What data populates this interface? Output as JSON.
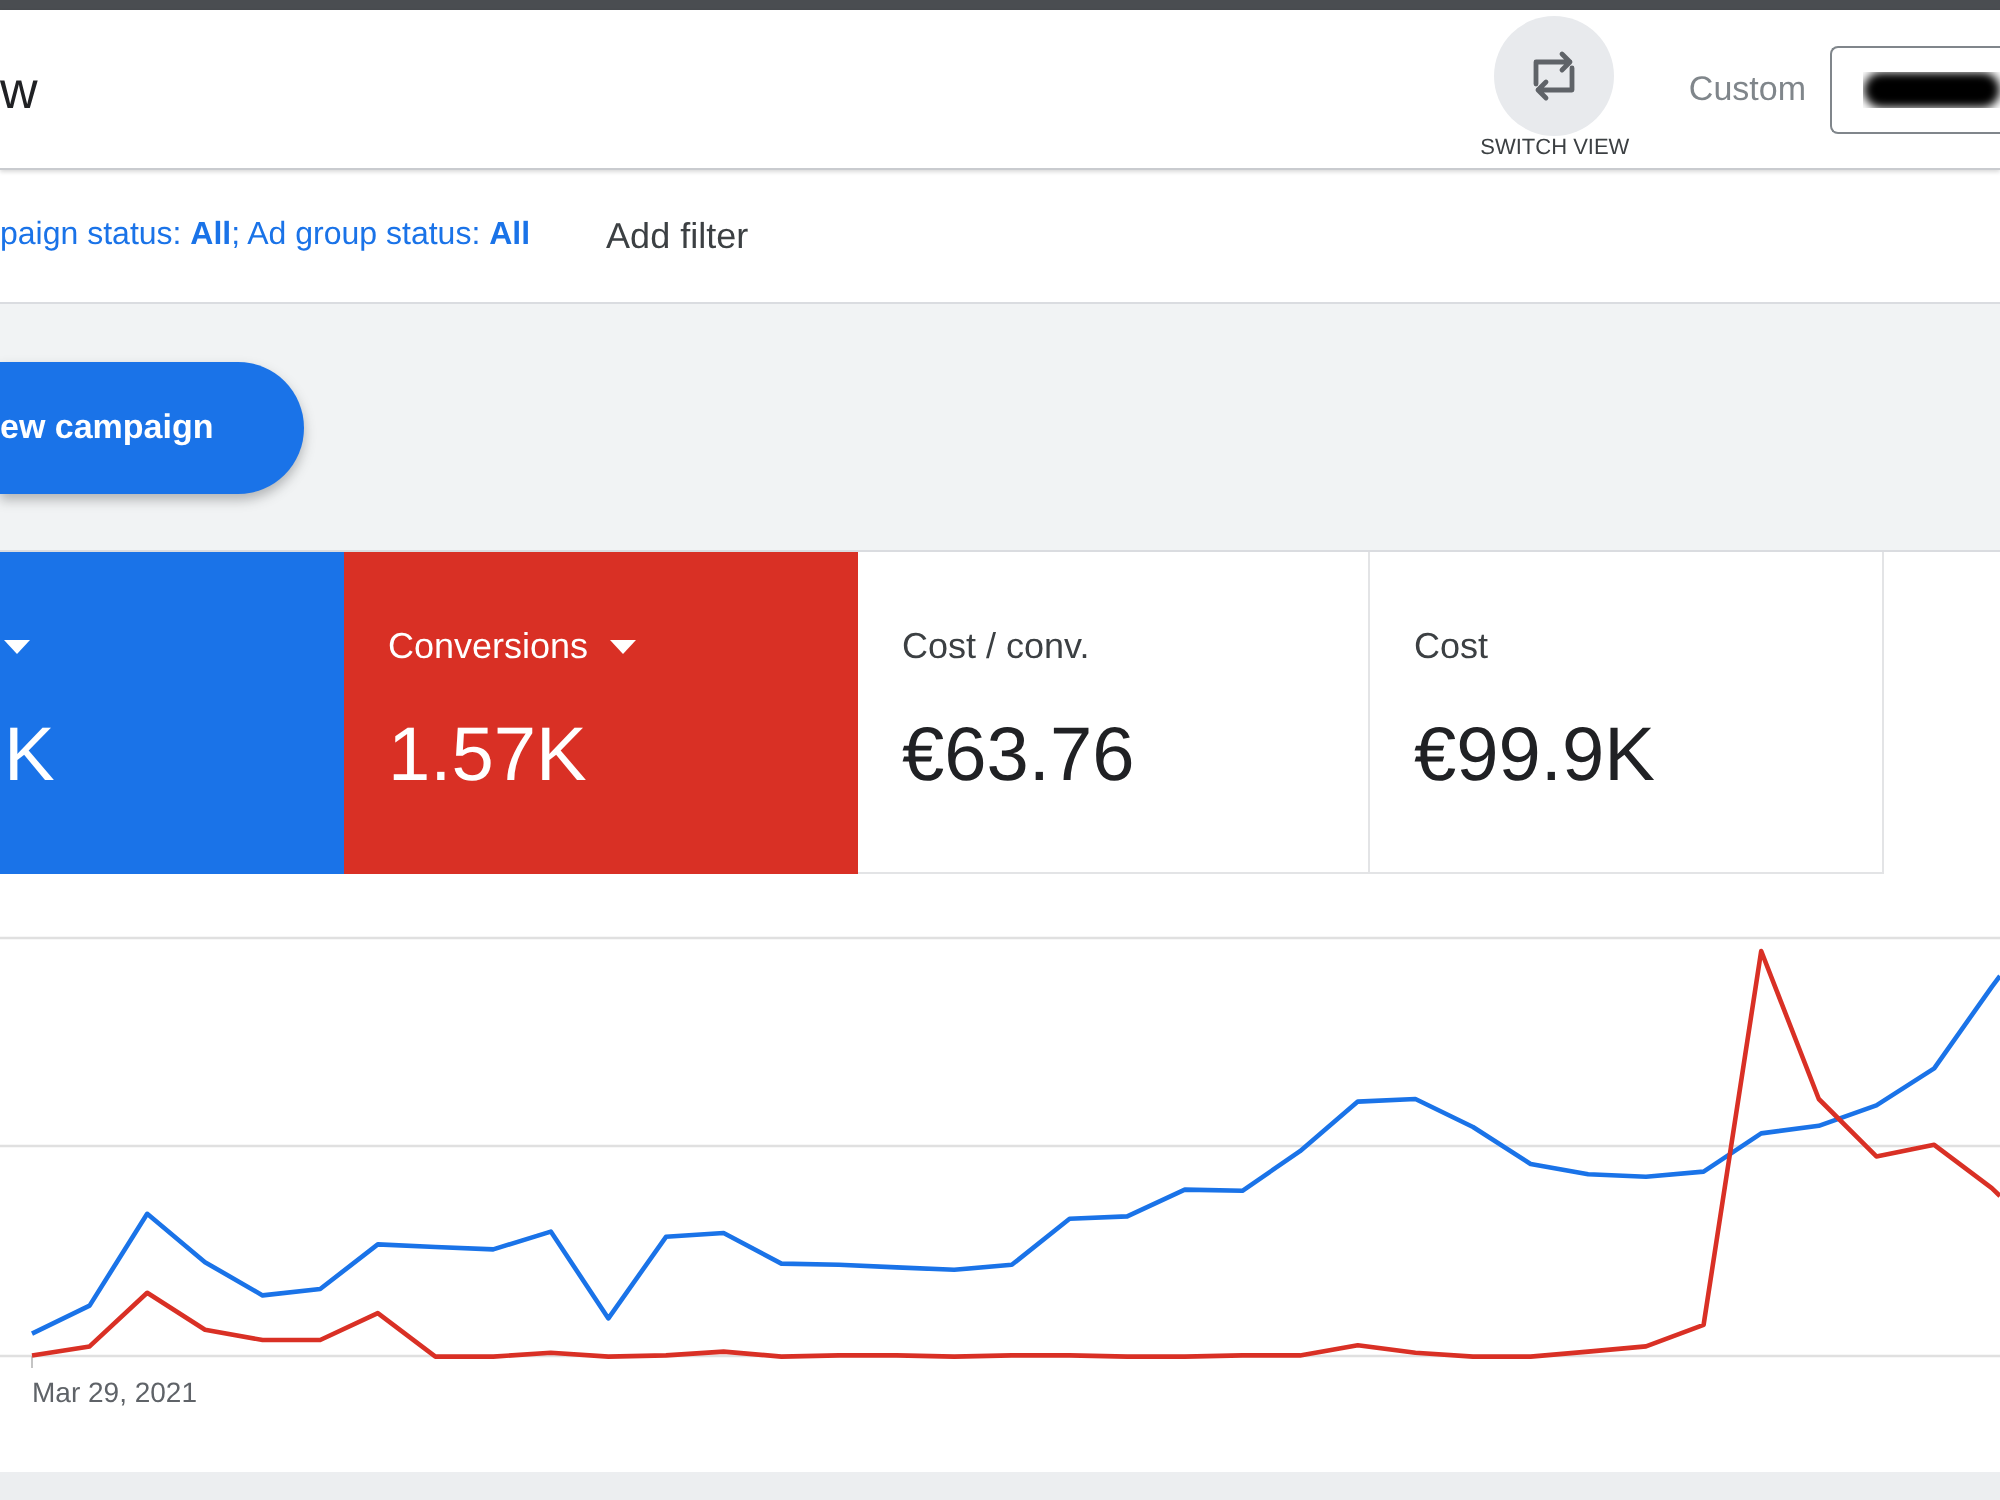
{
  "header": {
    "title": "w",
    "switch_view_label": "SWITCH VIEW",
    "date_range_label": "Custom"
  },
  "filter_bar": {
    "summary": "paign status: **All**; Ad group status: **All**",
    "add_filter": "Add filter"
  },
  "toolbar": {
    "new_campaign": "ew campaign"
  },
  "metric_cards": [
    {
      "value": "K",
      "selected": true,
      "color": "#1a73e8"
    },
    {
      "label": "Conversions",
      "value": "1.57K",
      "selected": true,
      "color": "#d93025"
    },
    {
      "label": "Cost / conv.",
      "value": "€63.76",
      "selected": false
    },
    {
      "label": "Cost",
      "value": "€99.9K",
      "selected": false
    }
  ],
  "chart": {
    "x_axis_label": "Mar 29, 2021"
  }
}
